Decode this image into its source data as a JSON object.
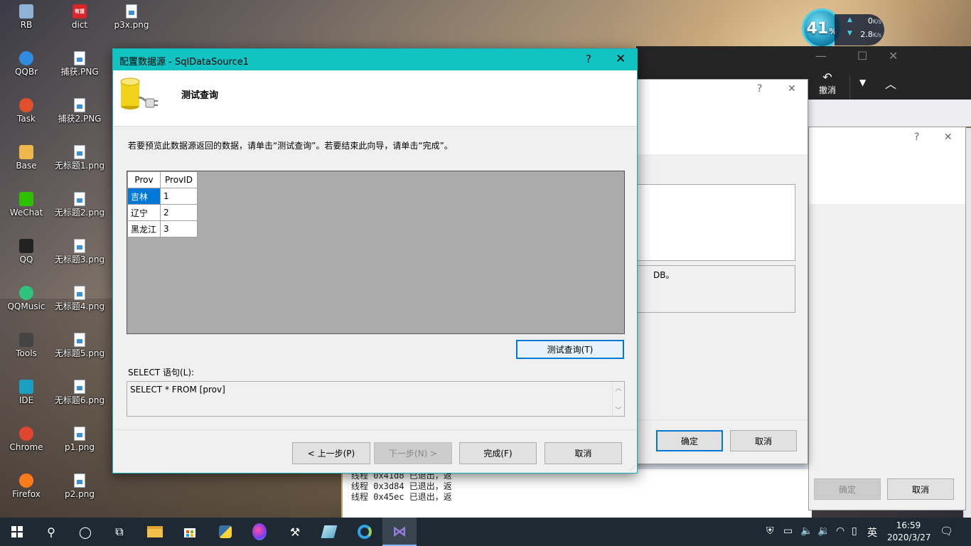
{
  "desktop": {
    "icons": [
      {
        "label": "RB",
        "icon": "recycle-bin-icon",
        "color": "#8fb2d6"
      },
      {
        "label": "dict",
        "icon": "dict-app-icon",
        "color": "#d9262a",
        "glyph": "有道"
      },
      {
        "label": "p3x.png",
        "icon": "image-file-icon"
      },
      {
        "label": "QQBr",
        "icon": "qq-browser-icon",
        "color": "#2f8be0"
      },
      {
        "label": "捕获.PNG",
        "icon": "image-file-icon"
      },
      {
        "label": "Task",
        "icon": "task-app-icon",
        "color": "#e0502a"
      },
      {
        "label": "捕获2.PNG",
        "icon": "image-file-icon"
      },
      {
        "label": "Base",
        "icon": "base-folder-icon",
        "color": "#f0b84a"
      },
      {
        "label": "无标题1.png",
        "icon": "image-file-icon"
      },
      {
        "label": "WeChat",
        "icon": "wechat-icon",
        "color": "#2dc100"
      },
      {
        "label": "无标题2.png",
        "icon": "image-file-icon"
      },
      {
        "label": "QQ",
        "icon": "qq-penguin-icon",
        "color": "#222222"
      },
      {
        "label": "无标题3.png",
        "icon": "image-file-icon"
      },
      {
        "label": "QQMusic",
        "icon": "qq-music-icon",
        "color": "#31c27c"
      },
      {
        "label": "无标题4.png",
        "icon": "image-file-icon"
      },
      {
        "label": "Tools",
        "icon": "tools-icon",
        "color": "#444444"
      },
      {
        "label": "无标题5.png",
        "icon": "image-file-icon"
      },
      {
        "label": "IDE",
        "icon": "ide-icon",
        "color": "#1a9ec4"
      },
      {
        "label": "无标题6.png",
        "icon": "image-file-icon"
      },
      {
        "label": "Chrome",
        "icon": "chrome-icon",
        "color": "#e0452f"
      },
      {
        "label": "p1.png",
        "icon": "image-file-icon"
      },
      {
        "label": "Firefox",
        "icon": "firefox-icon",
        "color": "#ff7a1a"
      },
      {
        "label": "p2.png",
        "icon": "image-file-icon"
      }
    ]
  },
  "net_widget": {
    "percent": "41",
    "percent_sign": "%",
    "upload": "0",
    "download": "2.8",
    "unit": "K/s"
  },
  "background": {
    "vs_toolbar": {
      "undo_label": "撤消"
    },
    "dialog1": {
      "help": "?",
      "close": "✕",
      "text_fragment": "DB。",
      "ok_label": "确定",
      "cancel_label": "取消"
    },
    "dialog2": {
      "help": "?",
      "close": "✕",
      "ok_label": "确定",
      "cancel_label": "取消"
    },
    "output_lines": [
      "线程 0x41d8 已退出，返",
      "线程 0x3d84 已退出，返",
      "线程 0x45ec 已退出，返"
    ]
  },
  "dialog": {
    "title": "配置数据源 - SqlDataSource1",
    "help": "?",
    "close": "✕",
    "header_title": "测试查询",
    "instruction": "若要预览此数据源返回的数据，请单击“测试查询”。若要结束此向导，请单击“完成”。",
    "columns": [
      "Prov",
      "ProvID"
    ],
    "rows": [
      [
        "吉林",
        "1"
      ],
      [
        "辽宁",
        "2"
      ],
      [
        "黑龙江",
        "3"
      ]
    ],
    "test_button": "测试查询(T)",
    "select_label": "SELECT 语句(L):",
    "select_text": "SELECT * FROM [prov]",
    "buttons": {
      "prev": "< 上一步(P)",
      "next": "下一步(N) >",
      "finish": "完成(F)",
      "cancel": "取消"
    },
    "accent_color": "#12c3c4"
  },
  "taskbar": {
    "items": [
      "windows-start-icon",
      "search-icon",
      "cortana-icon",
      "task-view-icon",
      "file-explorer-icon",
      "store-icon",
      "python-icon",
      "paint-icon",
      "tool-icon",
      "glass-icon",
      "edge-icon",
      "visual-studio-icon"
    ],
    "input_language": "英",
    "time": "16:59",
    "date": "2020/3/27"
  }
}
